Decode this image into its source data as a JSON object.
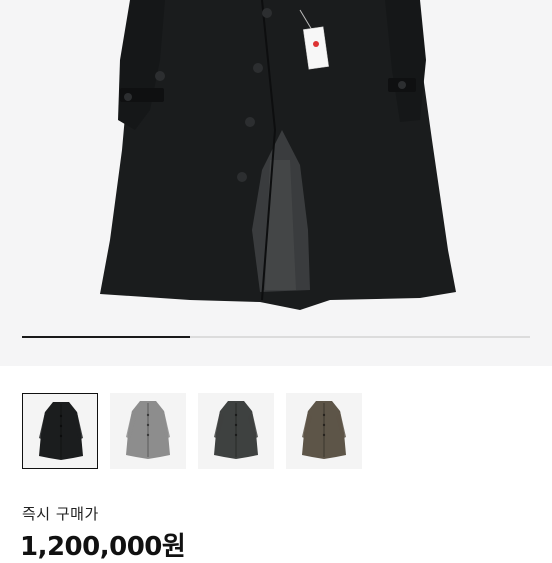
{
  "product": {
    "image_count": 4,
    "selected_index": 0,
    "carousel_progress": 0.33,
    "thumbnails": [
      {
        "name": "black-coat",
        "color": "#1b1d1e"
      },
      {
        "name": "grey-coat",
        "color": "#8d8d8d"
      },
      {
        "name": "charcoal-coat",
        "color": "#3e4140"
      },
      {
        "name": "brown-coat",
        "color": "#5d5548"
      }
    ]
  },
  "purchase": {
    "label": "즉시 구매가",
    "price": "1,200,000원"
  }
}
